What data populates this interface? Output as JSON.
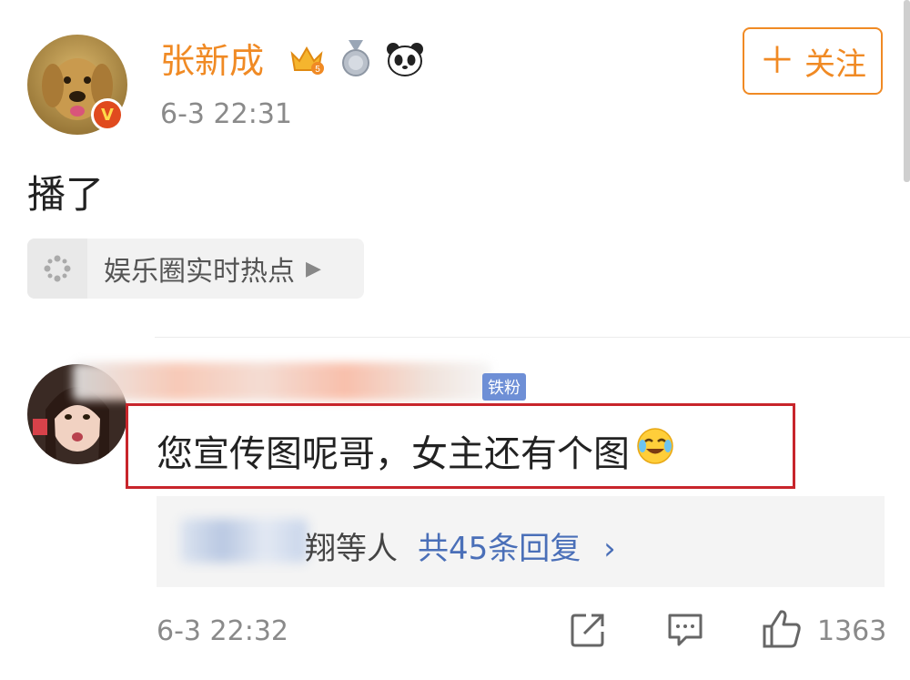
{
  "post": {
    "username": "张新成",
    "time": "6-3 22:31",
    "follow_label": "关注",
    "text": "播了",
    "topic_label": "娱乐圈实时热点"
  },
  "comment": {
    "fan_badge": "铁粉",
    "text": "您宣传图呢哥，女主还有个图",
    "replies_suffix": "翔等人",
    "replies_link": "共45条回复",
    "replies_chevron": "›",
    "time": "6-3 22:32",
    "like_count": "1363"
  },
  "colors": {
    "accent_orange": "#f08a24",
    "link_blue": "#4a6fb8",
    "highlight_red": "#c8252b"
  },
  "icons": [
    "vip-crown-icon",
    "medal-icon",
    "panda-icon",
    "share-icon",
    "reply-icon",
    "like-icon",
    "topic-sparkle-icon"
  ]
}
